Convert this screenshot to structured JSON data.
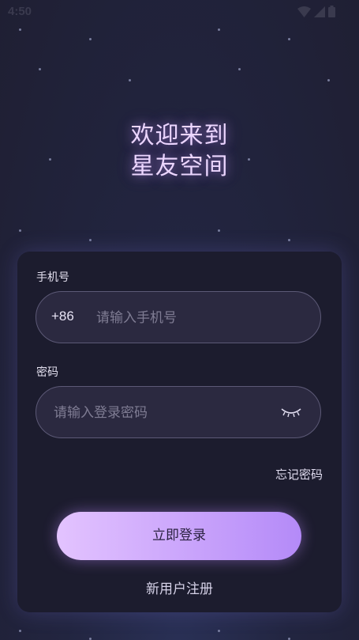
{
  "status_bar": {
    "time": "4:50",
    "icons": [
      "wifi-icon",
      "signal-icon",
      "battery-icon"
    ]
  },
  "welcome": {
    "line1": "欢迎来到",
    "line2": "星友空间"
  },
  "form": {
    "phone_label": "手机号",
    "phone_prefix": "+86",
    "phone_placeholder": "请输入手机号",
    "phone_value": "",
    "password_label": "密码",
    "password_placeholder": "请输入登录密码",
    "password_value": "",
    "password_toggle_icon": "eye-closed-icon",
    "forgot_label": "忘记密码",
    "login_label": "立即登录",
    "register_label": "新用户注册"
  },
  "colors": {
    "accent_start": "#e3c3ff",
    "accent_end": "#b48af8",
    "card_bg": "#1c1c2e",
    "title_glow": "#ecd6ff"
  }
}
